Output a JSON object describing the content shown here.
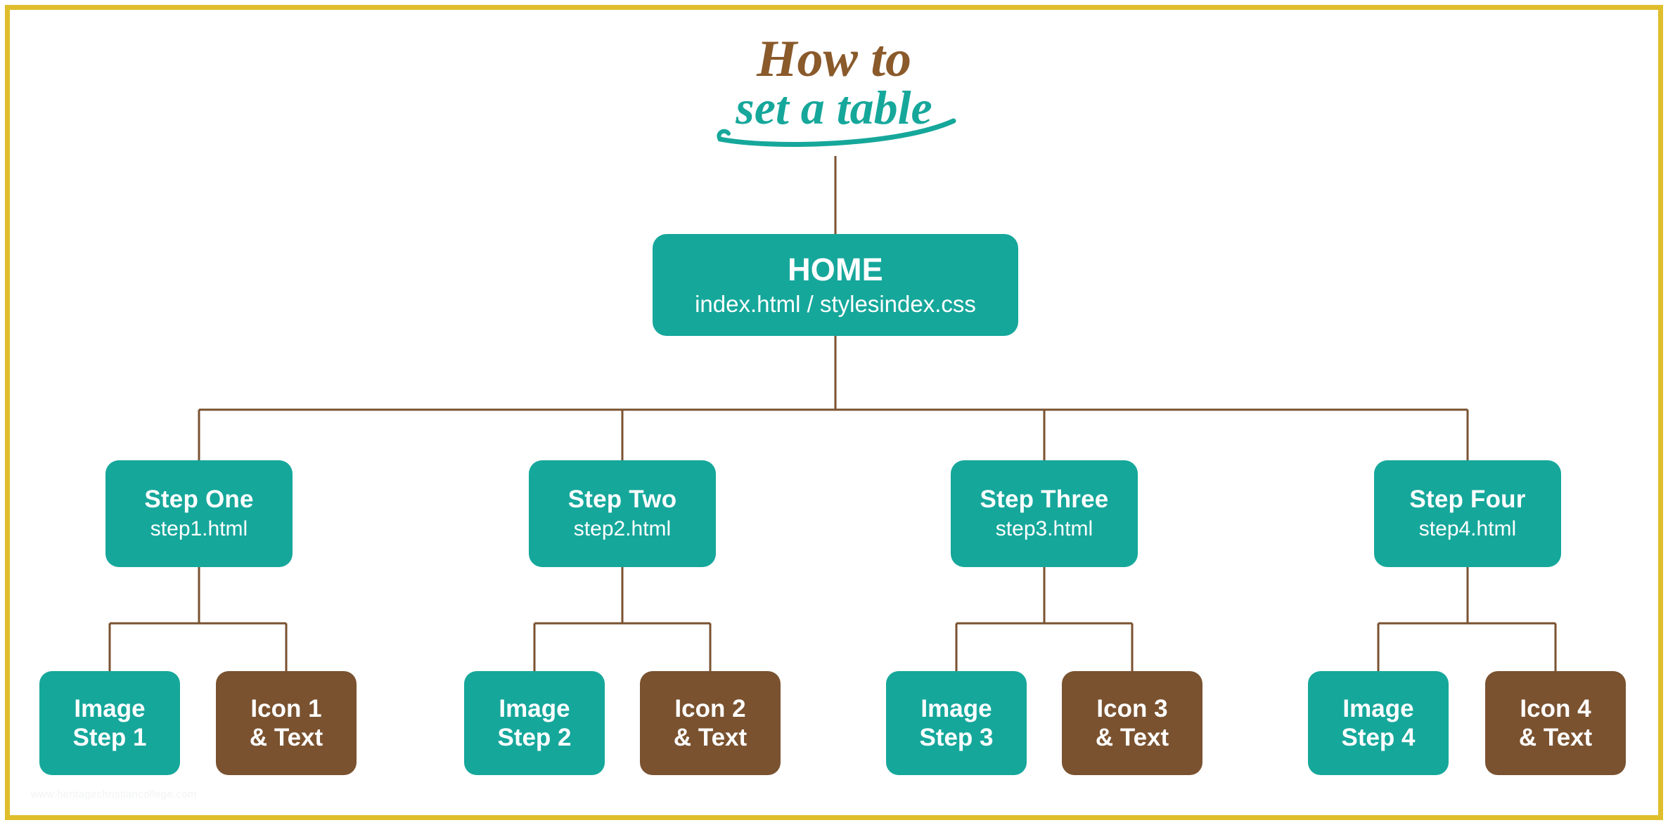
{
  "title": {
    "line1": "How to",
    "line2": "set a table",
    "line1_color": "#8a5a2b",
    "line2_color": "#16a79b"
  },
  "colors": {
    "teal": "#16a79b",
    "brown": "#7a5230",
    "frame": "#dfbe2c",
    "connector": "#7a5230",
    "node_text": "#ffffff",
    "background": "#ffffff"
  },
  "home": {
    "title": "HOME",
    "subtitle": "index.html / stylesindex.css"
  },
  "steps": [
    {
      "title": "Step One",
      "subtitle": "step1.html",
      "leaves": [
        {
          "line1": "Image",
          "line2": "Step 1",
          "style": "teal"
        },
        {
          "line1": "Icon 1",
          "line2": "& Text",
          "style": "brown"
        }
      ]
    },
    {
      "title": "Step Two",
      "subtitle": "step2.html",
      "leaves": [
        {
          "line1": "Image",
          "line2": "Step 2",
          "style": "teal"
        },
        {
          "line1": "Icon 2",
          "line2": "& Text",
          "style": "brown"
        }
      ]
    },
    {
      "title": "Step Three",
      "subtitle": "step3.html",
      "leaves": [
        {
          "line1": "Image",
          "line2": "Step 3",
          "style": "teal"
        },
        {
          "line1": "Icon 3",
          "line2": "& Text",
          "style": "brown"
        }
      ]
    },
    {
      "title": "Step Four",
      "subtitle": "step4.html",
      "leaves": [
        {
          "line1": "Image",
          "line2": "Step 4",
          "style": "teal"
        },
        {
          "line1": "Icon 4",
          "line2": "& Text",
          "style": "brown"
        }
      ]
    }
  ],
  "watermark": "www.heritagechristiancollege.com"
}
